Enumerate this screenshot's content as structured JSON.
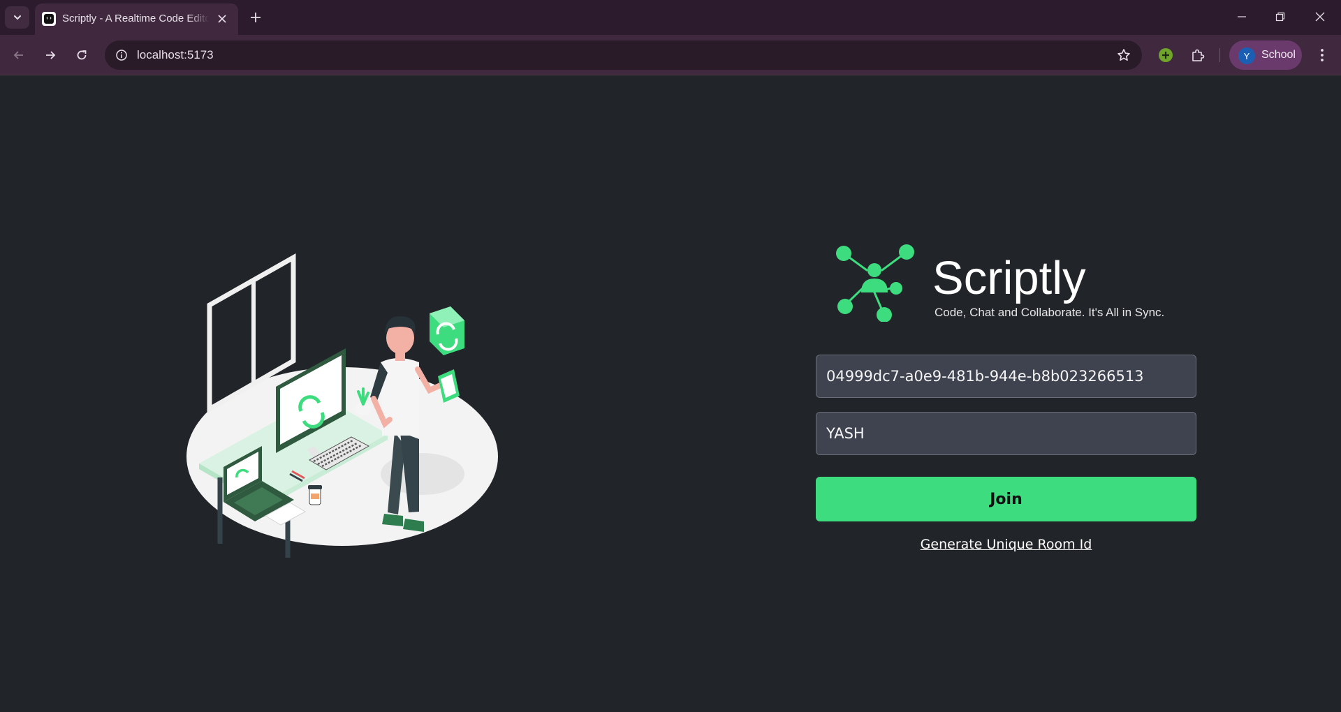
{
  "browser": {
    "tab_title": "Scriptly - A Realtime Code Editor",
    "url": "localhost:5173",
    "profile": {
      "initial": "Y",
      "label": "School"
    },
    "icons": [
      "tab-search-icon",
      "favicon-icon",
      "close-icon",
      "plus-icon",
      "minimize-icon",
      "restore-icon",
      "window-close-icon",
      "back-arrow-icon",
      "forward-arrow-icon",
      "reload-icon",
      "info-icon",
      "star-icon",
      "extension-add-icon",
      "puzzle-icon",
      "kebab-menu-icon"
    ]
  },
  "app": {
    "brand_name": "Scriptly",
    "tagline": "Code, Chat and Collaborate. It's All in Sync.",
    "room_id_value": "04999dc7-a0e9-481b-944e-b8b023266513",
    "username_value": "YASH",
    "join_label": "Join",
    "generate_link_label": "Generate Unique Room Id",
    "accent_color": "#3ddc7e",
    "background_color": "#212429"
  }
}
